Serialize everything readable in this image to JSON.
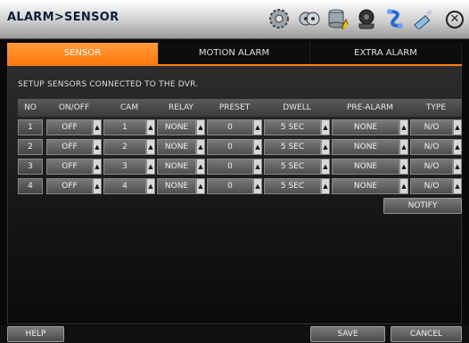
{
  "window": {
    "title": "ALARM>SENSOR"
  },
  "toolbar_icons": [
    "gear-icon",
    "tape-icon",
    "database-warning-icon",
    "camera-reel-icon",
    "network-icon",
    "usb-icon"
  ],
  "tabs": [
    {
      "label": "SENSOR",
      "active": true
    },
    {
      "label": "MOTION ALARM",
      "active": false
    },
    {
      "label": "EXTRA ALARM",
      "active": false
    }
  ],
  "description": "SETUP SENSORS CONNECTED TO THE DVR.",
  "table": {
    "headers": [
      "NO",
      "ON/OFF",
      "CAM",
      "RELAY",
      "PRESET",
      "DWELL",
      "PRE-ALARM",
      "TYPE"
    ],
    "rows": [
      {
        "no": "1",
        "onoff": "OFF",
        "cam": "1",
        "relay": "NONE",
        "preset": "0",
        "dwell": "5 SEC",
        "prealarm": "NONE",
        "type": "N/O"
      },
      {
        "no": "2",
        "onoff": "OFF",
        "cam": "2",
        "relay": "NONE",
        "preset": "0",
        "dwell": "5 SEC",
        "prealarm": "NONE",
        "type": "N/O"
      },
      {
        "no": "3",
        "onoff": "OFF",
        "cam": "3",
        "relay": "NONE",
        "preset": "0",
        "dwell": "5 SEC",
        "prealarm": "NONE",
        "type": "N/O"
      },
      {
        "no": "4",
        "onoff": "OFF",
        "cam": "4",
        "relay": "NONE",
        "preset": "0",
        "dwell": "5 SEC",
        "prealarm": "NONE",
        "type": "N/O"
      }
    ]
  },
  "buttons": {
    "notify": "NOTIFY",
    "help": "HELP",
    "save": "SAVE",
    "cancel": "CANCEL"
  },
  "colors": {
    "accent": "#ff7b10",
    "title_text": "#0e1e3a"
  }
}
